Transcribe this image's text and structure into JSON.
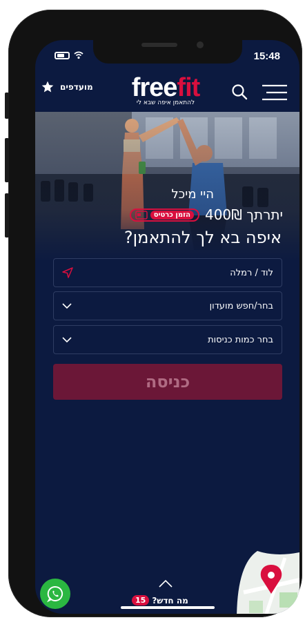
{
  "status_bar": {
    "time": "15:48"
  },
  "header": {
    "favorites_label": "מועדפים",
    "logo_free": "free",
    "logo_fit": "fit",
    "logo_tagline": "להתאמן איפה שבא לי"
  },
  "hero": {
    "greeting": "היי מיכל",
    "balance": "יתרתך 400₪",
    "voucher_label": "הזמן כרטיס",
    "question": "איפה בא לך להתאמן?"
  },
  "form": {
    "location_value": "לוד / רמלה",
    "club_placeholder": "בחר/חפש מועדון",
    "entries_placeholder": "בחר כמות כניסות",
    "submit_label": "כניסה"
  },
  "bottom": {
    "whats_new_label": "מה חדש?",
    "whats_new_count": "15"
  },
  "colors": {
    "background": "#0c1a40",
    "accent": "#d90f3e",
    "button": "#6b1737",
    "whatsapp": "#2bb741"
  },
  "icons": [
    "star-icon",
    "search-icon",
    "menu-icon",
    "card-icon",
    "locate-icon",
    "chevron-down-icon",
    "chevron-up-icon",
    "whatsapp-icon",
    "map-pin-icon"
  ]
}
